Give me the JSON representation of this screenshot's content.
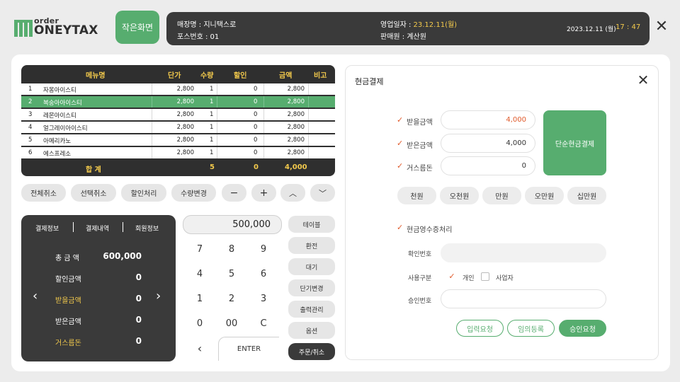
{
  "header": {
    "logo_small": "order",
    "logo_word": "ONEYTAX",
    "small_screen_label": "작은화면",
    "store_label": "매장명 : 지니택스로",
    "pos_label": "포스번호 : 01",
    "biz_date_label": "영업일자 : ",
    "biz_date_value": "23.12.11(월)",
    "cashier_label": "판매원 : 계산원",
    "date_text": "2023.12.11 (월)",
    "time_text": "17 : 47"
  },
  "table": {
    "headers": [
      "메뉴명",
      "단가",
      "수량",
      "할인",
      "금액",
      "비고"
    ],
    "rows": [
      {
        "no": "1",
        "name": "자몽아이스티",
        "price": "2,800",
        "qty": "1",
        "disc": "0",
        "amount": "2,800"
      },
      {
        "no": "2",
        "name": "복숭아아이스티",
        "price": "2,800",
        "qty": "1",
        "disc": "0",
        "amount": "2,800"
      },
      {
        "no": "3",
        "name": "레몬아이스티",
        "price": "2,800",
        "qty": "1",
        "disc": "0",
        "amount": "2,800"
      },
      {
        "no": "4",
        "name": "얼그레이아이스티",
        "price": "2,800",
        "qty": "1",
        "disc": "0",
        "amount": "2,800"
      },
      {
        "no": "5",
        "name": "아메리카노",
        "price": "2,800",
        "qty": "1",
        "disc": "0",
        "amount": "2,800"
      },
      {
        "no": "6",
        "name": "에스프레소",
        "price": "2,800",
        "qty": "1",
        "disc": "0",
        "amount": "2,800"
      }
    ],
    "total_label": "합   계",
    "total_qty": "5",
    "total_disc": "0",
    "total_amount": "4,000"
  },
  "actions": [
    "전체취소",
    "선택취소",
    "할인처리",
    "수량변경",
    "−",
    "+",
    "⌃",
    "⌄"
  ],
  "pay_info": {
    "tabs": [
      "결제정보",
      "결제내역",
      "회원정보"
    ],
    "rows": [
      {
        "label": "총 금 액",
        "value": "600,000"
      },
      {
        "label": "할인금액",
        "value": "0"
      },
      {
        "label": "받을금액",
        "value": "0"
      },
      {
        "label": "받은금액",
        "value": "0"
      },
      {
        "label": "거스름돈",
        "value": "0"
      }
    ],
    "highlight_color": "#f2c94c"
  },
  "keypad": {
    "display": "500,000",
    "keys": [
      "7",
      "8",
      "9",
      "4",
      "5",
      "6",
      "1",
      "2",
      "3",
      "0",
      "00",
      "C"
    ],
    "back": "‹",
    "enter": "ENTER"
  },
  "side_buttons": [
    "테이블",
    "환전",
    "대기",
    "단기변경",
    "출력관리",
    "옵션",
    "주문/취소"
  ],
  "cash": {
    "title": "현금결제",
    "receive_label": "받을금액",
    "receive_value": "4,000",
    "received_label": "받은금액",
    "received_value": "4,000",
    "change_label": "거스름돈",
    "change_value": "0",
    "simple_btn": "단순현금결제",
    "money_buttons": [
      "천원",
      "오천원",
      "만원",
      "오만원",
      "십만원"
    ],
    "receipt_label": "현금영수증처리",
    "confirm_label": "확인번호",
    "usage_label": "사용구분",
    "personal_label": "개인",
    "business_label": "사업자",
    "approval_label": "승인번호",
    "btn_input": "입력요청",
    "btn_temp": "임의등록",
    "btn_approve": "승인요청",
    "accent": "#57ad6f",
    "orange": "#e05a2b"
  }
}
